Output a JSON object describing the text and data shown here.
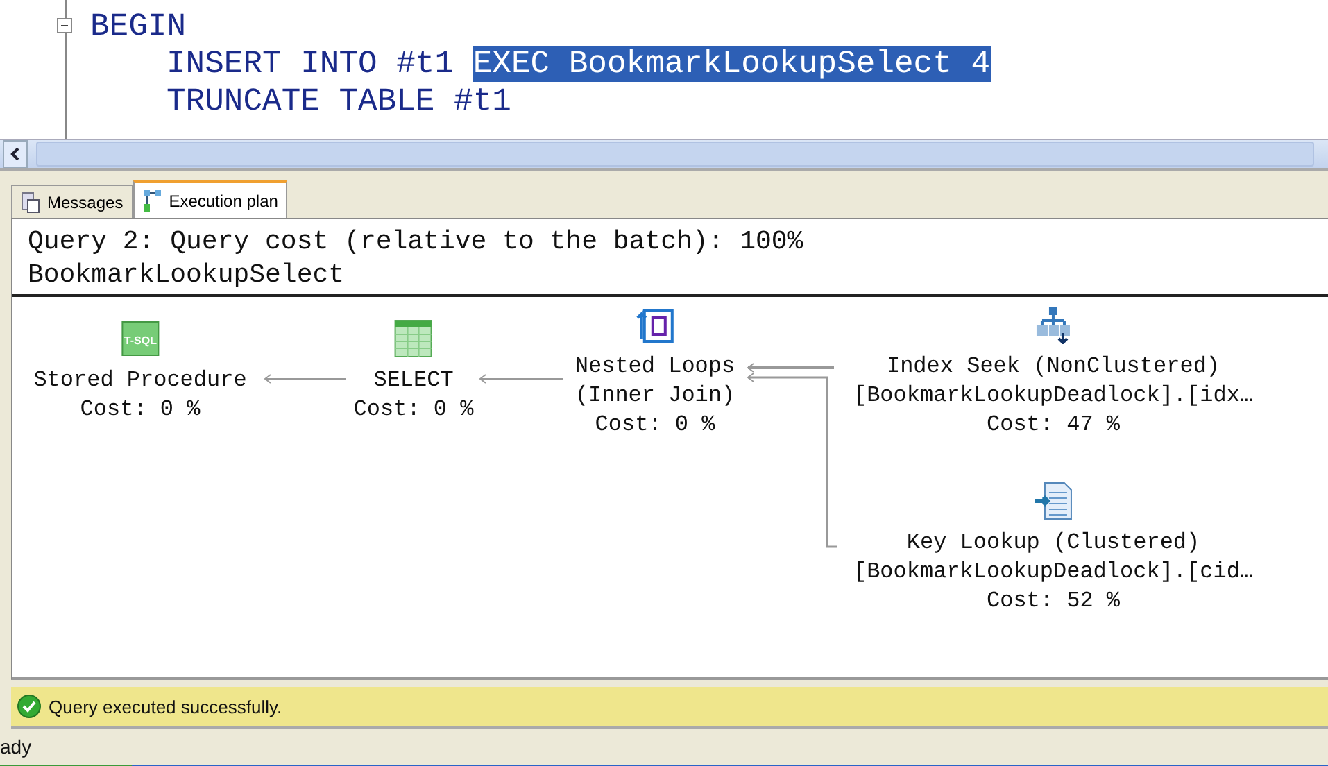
{
  "editor": {
    "lines": [
      {
        "kind": "fold",
        "parts": [
          {
            "text": "BEGIN",
            "selected": false
          }
        ]
      },
      {
        "kind": "code",
        "parts": [
          {
            "text": "INSERT INTO #t1 ",
            "selected": false
          },
          {
            "text": "EXEC BookmarkLookupSelect 4",
            "selected": true
          }
        ]
      },
      {
        "kind": "code",
        "parts": [
          {
            "text": "TRUNCATE TABLE #t1",
            "selected": false
          }
        ]
      }
    ]
  },
  "tabs": [
    {
      "label": "Messages",
      "kind": "messages",
      "selected": false
    },
    {
      "label": "Execution plan",
      "kind": "plan",
      "selected": true
    }
  ],
  "plan": {
    "header": [
      "Query 2: Query cost (relative to the batch): 100%",
      "BookmarkLookupSelect"
    ],
    "nodes": [
      {
        "kind": "tsql",
        "icon_text": "T-SQL",
        "lines": [
          "Stored Procedure"
        ],
        "cost": "Cost: 0 %"
      },
      {
        "kind": "select",
        "lines": [
          "SELECT"
        ],
        "cost": "Cost: 0 %"
      },
      {
        "kind": "loops",
        "lines": [
          "Nested Loops",
          "(Inner Join)"
        ],
        "cost": "Cost: 0 %"
      },
      {
        "kind": "seek",
        "lines": [
          "Index Seek (NonClustered)",
          "[BookmarkLookupDeadlock].[idx…"
        ],
        "cost": "Cost: 47 %"
      },
      {
        "kind": "lookup",
        "lines": [
          "Key Lookup (Clustered)",
          "[BookmarkLookupDeadlock].[cid…"
        ],
        "cost": "Cost: 52 %"
      }
    ]
  },
  "message": "Query executed successfully.",
  "status_bar": "ady"
}
